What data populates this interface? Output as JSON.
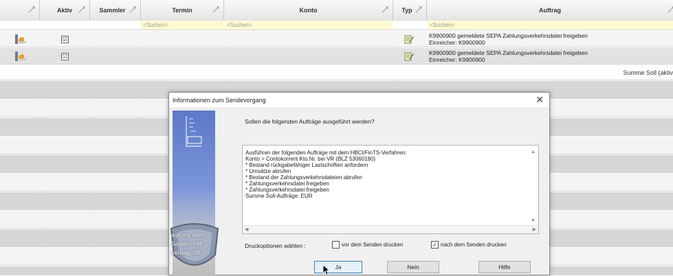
{
  "columns": [
    {
      "label": "",
      "icon": "sort-icon"
    },
    {
      "label": "Aktiv",
      "icon": "sort-icon"
    },
    {
      "label": "Sammler",
      "icon": "sort-icon"
    },
    {
      "label": "Termin",
      "icon": "sort-icon"
    },
    {
      "label": "Konto",
      "icon": "sort-icon"
    },
    {
      "label": "Typ",
      "icon": "sort-icon"
    },
    {
      "label": "Auftrag",
      "icon": "sort-icon"
    }
  ],
  "search_placeholder": "<Suchen>",
  "rows": [
    {
      "status_icon": "order-status-icon",
      "aktiv": "☑",
      "typ_icon": "edit-document-icon",
      "line1": "K9900900 gemeldete SEPA Zahlungsverkehrsdatei freigeben",
      "line2": "Einreicher: K9900900"
    },
    {
      "status_icon": "order-status-icon",
      "aktiv": "☑",
      "typ_icon": "edit-document-icon",
      "line1": "K9900900 gemeldete SEPA Zahlungsverkehrsdatei freigeben",
      "line2": "Einreicher: K9900900"
    }
  ],
  "summary_label": "Summe Soll (aktiv",
  "dialog": {
    "title": "Informationen zum Sendevorgang",
    "close_glyph": "✕",
    "question": "Sollen die folgenden Aufträge ausgeführt werden?",
    "art_lines": [
      "age vor dem",
      "Sarbei - Hilf",
      "neistag, 28"
    ],
    "list_lines": [
      "Ausführen der folgenden Aufträge mit dem HBCI/FinTS-Verfahren:",
      "Konto >                Contokorrent Kto.Nr.                bei VR                                             (BLZ 53060180)",
      "* Bestand rückgabefähiger Lastschriften anfordern",
      "* Umsätze abrufen",
      "* Bestand der Zahlungsverkehrsdateien abrufen",
      "* Zahlungsverkehrsdatei freigeben",
      "* Zahlungsverkehrsdatei freigeben",
      "Summe Soll-Aufträge:                               EUR"
    ],
    "print_label": "Druckoptionen wählen :",
    "opt_before": {
      "label": "vor dem Senden drucken",
      "checked": ""
    },
    "opt_after": {
      "label": "nach dem Senden drucken",
      "checked": "✓"
    },
    "buttons": {
      "yes": "Ja",
      "no": "Nein",
      "help": "Hilfe"
    }
  }
}
